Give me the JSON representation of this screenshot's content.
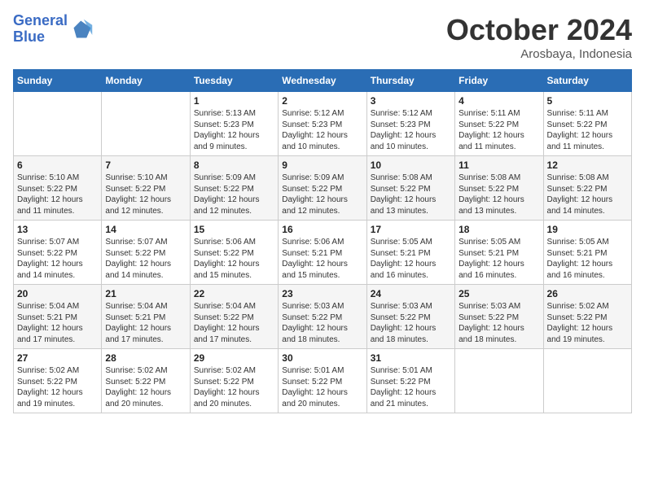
{
  "header": {
    "logo_line1": "General",
    "logo_line2": "Blue",
    "month": "October 2024",
    "location": "Arosbaya, Indonesia"
  },
  "weekdays": [
    "Sunday",
    "Monday",
    "Tuesday",
    "Wednesday",
    "Thursday",
    "Friday",
    "Saturday"
  ],
  "weeks": [
    [
      null,
      null,
      {
        "day": 1,
        "sunrise": "5:13 AM",
        "sunset": "5:23 PM",
        "daylight": "12 hours and 9 minutes."
      },
      {
        "day": 2,
        "sunrise": "5:12 AM",
        "sunset": "5:23 PM",
        "daylight": "12 hours and 10 minutes."
      },
      {
        "day": 3,
        "sunrise": "5:12 AM",
        "sunset": "5:23 PM",
        "daylight": "12 hours and 10 minutes."
      },
      {
        "day": 4,
        "sunrise": "5:11 AM",
        "sunset": "5:22 PM",
        "daylight": "12 hours and 11 minutes."
      },
      {
        "day": 5,
        "sunrise": "5:11 AM",
        "sunset": "5:22 PM",
        "daylight": "12 hours and 11 minutes."
      }
    ],
    [
      {
        "day": 6,
        "sunrise": "5:10 AM",
        "sunset": "5:22 PM",
        "daylight": "12 hours and 11 minutes."
      },
      {
        "day": 7,
        "sunrise": "5:10 AM",
        "sunset": "5:22 PM",
        "daylight": "12 hours and 12 minutes."
      },
      {
        "day": 8,
        "sunrise": "5:09 AM",
        "sunset": "5:22 PM",
        "daylight": "12 hours and 12 minutes."
      },
      {
        "day": 9,
        "sunrise": "5:09 AM",
        "sunset": "5:22 PM",
        "daylight": "12 hours and 12 minutes."
      },
      {
        "day": 10,
        "sunrise": "5:08 AM",
        "sunset": "5:22 PM",
        "daylight": "12 hours and 13 minutes."
      },
      {
        "day": 11,
        "sunrise": "5:08 AM",
        "sunset": "5:22 PM",
        "daylight": "12 hours and 13 minutes."
      },
      {
        "day": 12,
        "sunrise": "5:08 AM",
        "sunset": "5:22 PM",
        "daylight": "12 hours and 14 minutes."
      }
    ],
    [
      {
        "day": 13,
        "sunrise": "5:07 AM",
        "sunset": "5:22 PM",
        "daylight": "12 hours and 14 minutes."
      },
      {
        "day": 14,
        "sunrise": "5:07 AM",
        "sunset": "5:22 PM",
        "daylight": "12 hours and 14 minutes."
      },
      {
        "day": 15,
        "sunrise": "5:06 AM",
        "sunset": "5:22 PM",
        "daylight": "12 hours and 15 minutes."
      },
      {
        "day": 16,
        "sunrise": "5:06 AM",
        "sunset": "5:21 PM",
        "daylight": "12 hours and 15 minutes."
      },
      {
        "day": 17,
        "sunrise": "5:05 AM",
        "sunset": "5:21 PM",
        "daylight": "12 hours and 16 minutes."
      },
      {
        "day": 18,
        "sunrise": "5:05 AM",
        "sunset": "5:21 PM",
        "daylight": "12 hours and 16 minutes."
      },
      {
        "day": 19,
        "sunrise": "5:05 AM",
        "sunset": "5:21 PM",
        "daylight": "12 hours and 16 minutes."
      }
    ],
    [
      {
        "day": 20,
        "sunrise": "5:04 AM",
        "sunset": "5:21 PM",
        "daylight": "12 hours and 17 minutes."
      },
      {
        "day": 21,
        "sunrise": "5:04 AM",
        "sunset": "5:21 PM",
        "daylight": "12 hours and 17 minutes."
      },
      {
        "day": 22,
        "sunrise": "5:04 AM",
        "sunset": "5:22 PM",
        "daylight": "12 hours and 17 minutes."
      },
      {
        "day": 23,
        "sunrise": "5:03 AM",
        "sunset": "5:22 PM",
        "daylight": "12 hours and 18 minutes."
      },
      {
        "day": 24,
        "sunrise": "5:03 AM",
        "sunset": "5:22 PM",
        "daylight": "12 hours and 18 minutes."
      },
      {
        "day": 25,
        "sunrise": "5:03 AM",
        "sunset": "5:22 PM",
        "daylight": "12 hours and 18 minutes."
      },
      {
        "day": 26,
        "sunrise": "5:02 AM",
        "sunset": "5:22 PM",
        "daylight": "12 hours and 19 minutes."
      }
    ],
    [
      {
        "day": 27,
        "sunrise": "5:02 AM",
        "sunset": "5:22 PM",
        "daylight": "12 hours and 19 minutes."
      },
      {
        "day": 28,
        "sunrise": "5:02 AM",
        "sunset": "5:22 PM",
        "daylight": "12 hours and 20 minutes."
      },
      {
        "day": 29,
        "sunrise": "5:02 AM",
        "sunset": "5:22 PM",
        "daylight": "12 hours and 20 minutes."
      },
      {
        "day": 30,
        "sunrise": "5:01 AM",
        "sunset": "5:22 PM",
        "daylight": "12 hours and 20 minutes."
      },
      {
        "day": 31,
        "sunrise": "5:01 AM",
        "sunset": "5:22 PM",
        "daylight": "12 hours and 21 minutes."
      },
      null,
      null
    ]
  ]
}
